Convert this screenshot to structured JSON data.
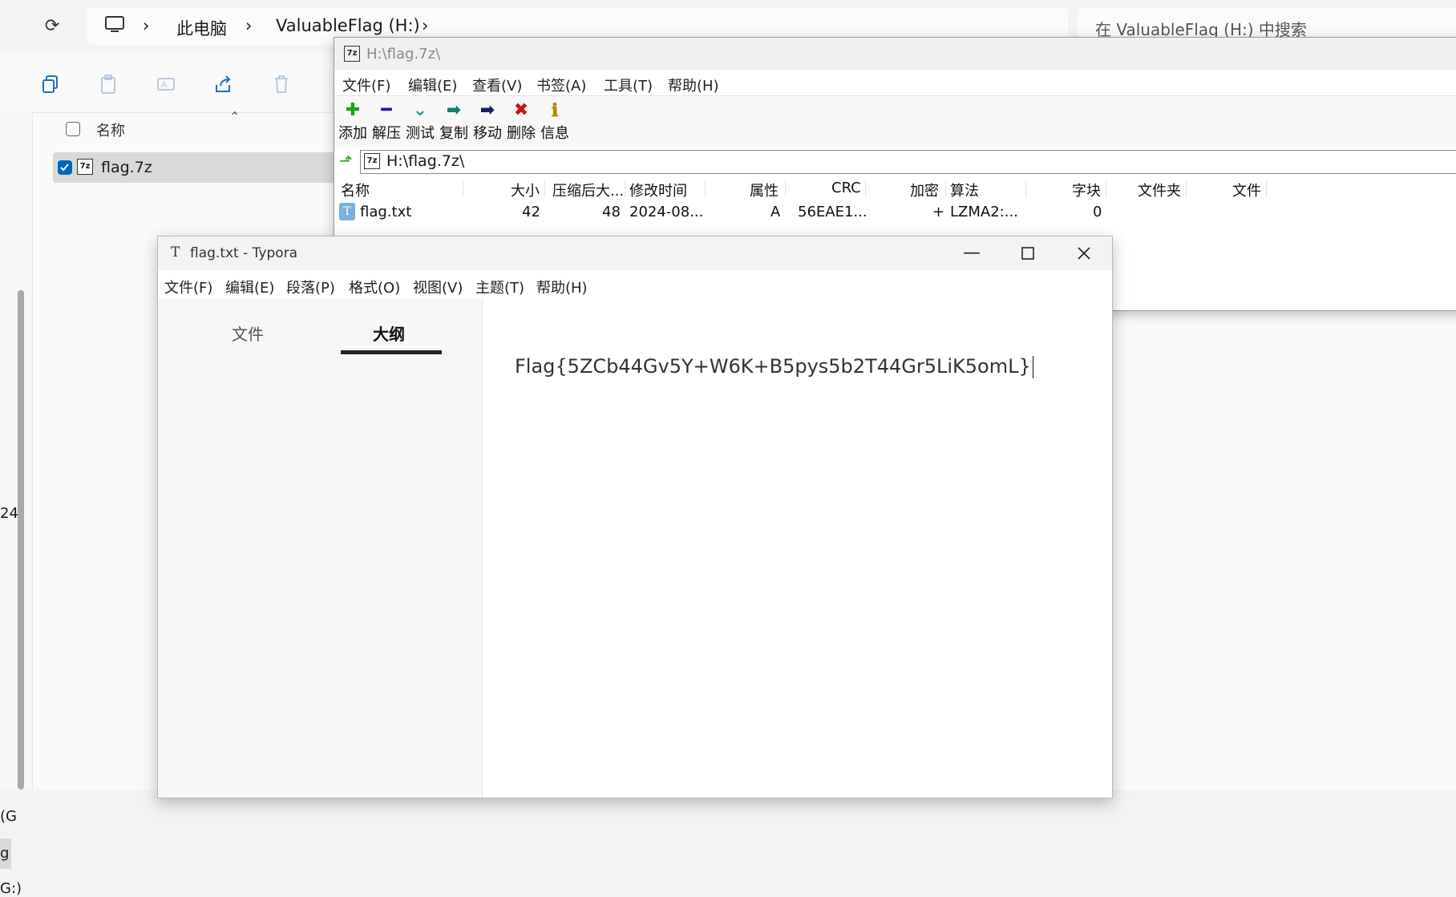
{
  "explorer": {
    "breadcrumb": [
      "此电脑",
      "ValuableFlag (H:)"
    ],
    "search_placeholder": "在 ValuableFlag (H:) 中搜索",
    "column_name": "名称",
    "file": "flag.7z",
    "nav_fragments": [
      "24",
      "(G",
      "g",
      "G:)"
    ]
  },
  "zip": {
    "title": "H:\\flag.7z\\",
    "menu": [
      "文件(F)",
      "编辑(E)",
      "查看(V)",
      "书签(A)",
      "工具(T)",
      "帮助(H)"
    ],
    "toolbar": [
      {
        "label": "添加",
        "icon": "add-icon",
        "glyph": "✚",
        "color": "#1aa31a"
      },
      {
        "label": "解压",
        "icon": "extract-icon",
        "glyph": "━",
        "color": "#1a1aa0"
      },
      {
        "label": "测试",
        "icon": "test-icon",
        "glyph": "⌄",
        "color": "#19a0a0"
      },
      {
        "label": "复制",
        "icon": "copy-icon",
        "glyph": "➡",
        "color": "#13806e"
      },
      {
        "label": "移动",
        "icon": "move-icon",
        "glyph": "➡",
        "color": "#1a1a70"
      },
      {
        "label": "删除",
        "icon": "delete-icon",
        "glyph": "✖",
        "color": "#d01010"
      },
      {
        "label": "信息",
        "icon": "info-icon",
        "glyph": "ℹ",
        "color": "#b08a00"
      }
    ],
    "path": "H:\\flag.7z\\",
    "columns": [
      "名称",
      "大小",
      "压缩后大...",
      "修改时间",
      "属性",
      "CRC",
      "加密",
      "算法",
      "字块",
      "文件夹",
      "文件"
    ],
    "row": {
      "name": "flag.txt",
      "size": "42",
      "packed": "48",
      "modified": "2024-08...",
      "attr": "A",
      "crc": "56EAE1...",
      "encrypted": "+",
      "method": "LZMA2:...",
      "block": "0"
    }
  },
  "typora": {
    "title": "flag.txt - Typora",
    "menu": [
      "文件(F)",
      "编辑(E)",
      "段落(P)",
      "格式(O)",
      "视图(V)",
      "主题(T)",
      "帮助(H)"
    ],
    "tabs": [
      "文件",
      "大纲"
    ],
    "active_tab": "大纲",
    "content": "Flag{5ZCb44Gv5Y+W6K+B5pys5b2T44Gr5LiK5omL}"
  },
  "colors": {
    "accent": "#0067c0",
    "selection": "#d9d9d9"
  }
}
